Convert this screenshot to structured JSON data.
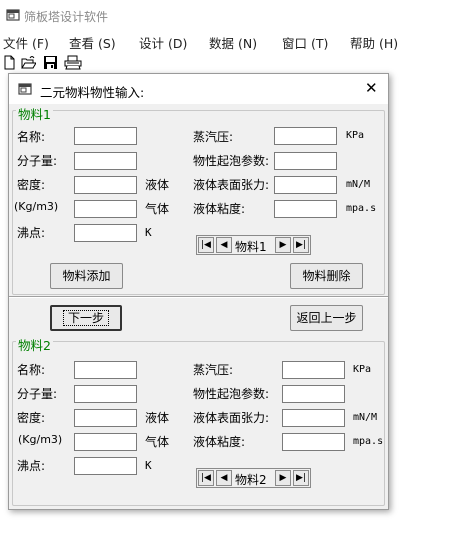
{
  "app": {
    "title": "筛板塔设计软件",
    "icon": "app-window-icon"
  },
  "menubar": [
    {
      "label": "文件 (F)"
    },
    {
      "label": "查看 (S)"
    },
    {
      "label": "设计 (D)"
    },
    {
      "label": "数据 (N)"
    },
    {
      "label": "窗口 (T)"
    },
    {
      "label": "帮助 (H)"
    }
  ],
  "toolbar": {
    "icons": [
      "new-file-icon",
      "open-folder-icon",
      "save-icon",
      "print-icon"
    ]
  },
  "dialog": {
    "title": "二元物料物性输入:",
    "close_symbol": "✕",
    "next_button": "下一步",
    "back_button": "返回上一步",
    "material1": {
      "group_label": "物料1",
      "name_label": "名称:",
      "mw_label": "分子量:",
      "density_label": "密度:",
      "density_unit": "(Kg/m3)",
      "liquid_label": "液体",
      "gas_label": "气体",
      "bp_label": "沸点:",
      "bp_unit": "K",
      "vp_label": "蒸汽压:",
      "vp_unit": "KPa",
      "bubble_label": "物性起泡参数:",
      "tension_label": "液体表面张力:",
      "tension_unit": "mN/M",
      "viscosity_label": "液体粘度:",
      "viscosity_unit": "mpa.s",
      "nav_label": "物料1",
      "add_button": "物料添加",
      "delete_button": "物料删除",
      "fields": {
        "name": "",
        "mw": "",
        "density_liquid": "",
        "density_gas": "",
        "bp": "",
        "vp": "",
        "bubble": "",
        "tension": "",
        "viscosity": ""
      }
    },
    "material2": {
      "group_label": "物料2",
      "name_label": "名称:",
      "mw_label": "分子量:",
      "density_label": "密度:",
      "density_unit": "(Kg/m3)",
      "liquid_label": "液体",
      "gas_label": "气体",
      "bp_label": "沸点:",
      "bp_unit": "K",
      "vp_label": "蒸汽压:",
      "vp_unit": "KPa",
      "bubble_label": "物性起泡参数:",
      "tension_label": "液体表面张力:",
      "tension_unit": "mN/M",
      "viscosity_label": "液体粘度:",
      "viscosity_unit": "mpa.s",
      "nav_label": "物料2",
      "fields": {
        "name": "",
        "mw": "",
        "density_liquid": "",
        "density_gas": "",
        "bp": "",
        "vp": "",
        "bubble": "",
        "tension": "",
        "viscosity": ""
      }
    }
  }
}
